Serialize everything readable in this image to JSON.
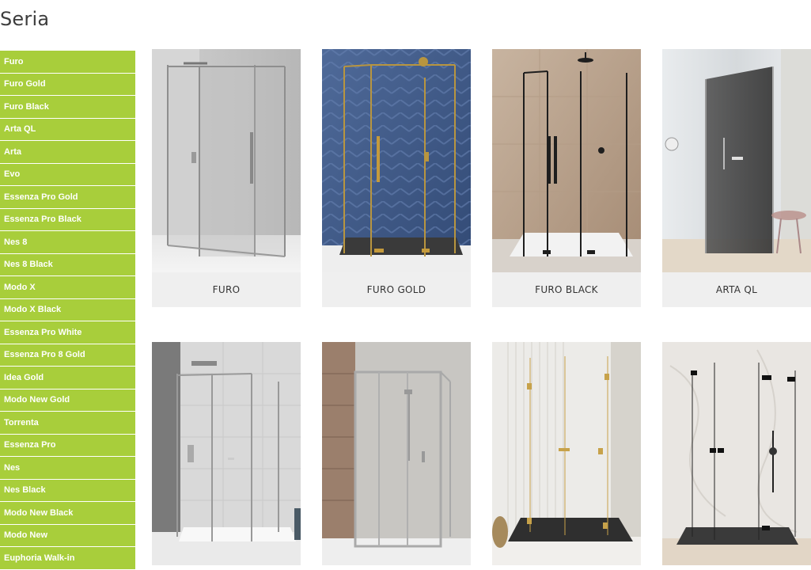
{
  "page": {
    "title": "Seria"
  },
  "sidebar": {
    "items": [
      {
        "label": "Furo"
      },
      {
        "label": "Furo Gold"
      },
      {
        "label": "Furo Black"
      },
      {
        "label": "Arta QL"
      },
      {
        "label": "Arta"
      },
      {
        "label": "Evo"
      },
      {
        "label": "Essenza Pro Gold"
      },
      {
        "label": "Essenza Pro Black"
      },
      {
        "label": "Nes 8"
      },
      {
        "label": "Nes 8 Black"
      },
      {
        "label": "Modo X"
      },
      {
        "label": "Modo X Black"
      },
      {
        "label": "Essenza Pro White"
      },
      {
        "label": "Essenza Pro 8 Gold"
      },
      {
        "label": "Idea Gold"
      },
      {
        "label": "Modo New Gold"
      },
      {
        "label": "Torrenta"
      },
      {
        "label": "Essenza Pro"
      },
      {
        "label": "Nes"
      },
      {
        "label": "Nes Black"
      },
      {
        "label": "Modo New Black"
      },
      {
        "label": "Modo New"
      },
      {
        "label": "Euphoria Walk-in"
      }
    ]
  },
  "products": [
    {
      "name": "FURO"
    },
    {
      "name": "FURO GOLD"
    },
    {
      "name": "FURO BLACK"
    },
    {
      "name": "ARTA QL"
    },
    {
      "name": ""
    },
    {
      "name": ""
    },
    {
      "name": ""
    },
    {
      "name": ""
    }
  ],
  "colors": {
    "sidebar_bg": "#a8ce3b",
    "caption_bg": "#efefef",
    "title": "#3d3d3d"
  }
}
